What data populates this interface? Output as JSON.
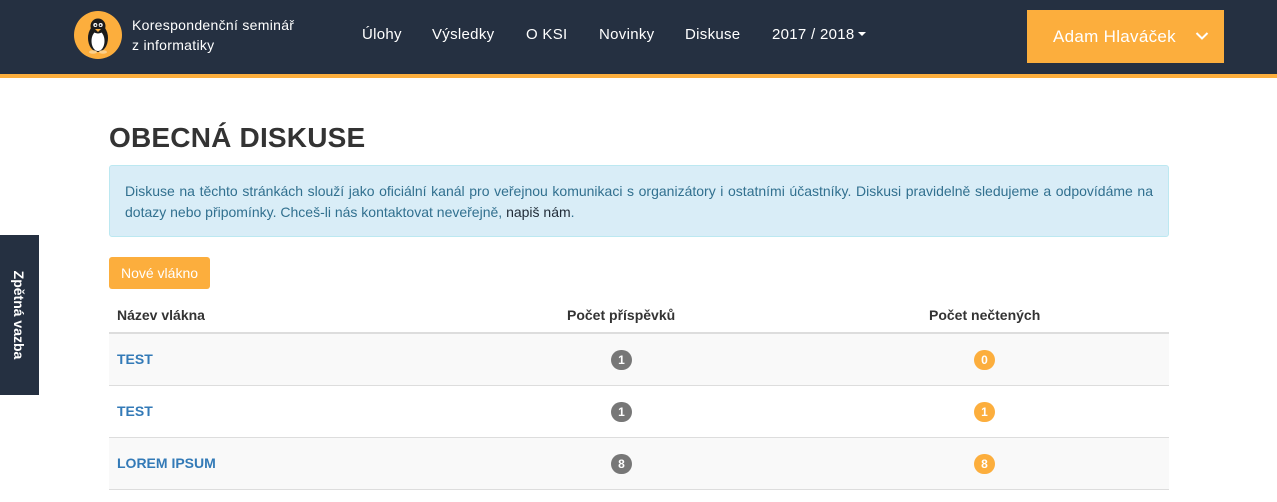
{
  "brand": {
    "line1": "Korespondenční seminář",
    "line2": "z informatiky"
  },
  "nav": {
    "items": [
      {
        "label": "Úlohy"
      },
      {
        "label": "Výsledky"
      },
      {
        "label": "O KSI"
      },
      {
        "label": "Novinky"
      },
      {
        "label": "Diskuse"
      }
    ],
    "year": "2017 / 2018",
    "user": "Adam Hlaváček"
  },
  "feedback": {
    "label": "Zpětná vazba"
  },
  "page": {
    "title": "OBECNÁ DISKUSE",
    "info_text": "Diskuse na těchto stránkách slouží jako oficiální kanál pro veřejnou komunikaci s organizátory i ostatními účastníky. Diskusi pravidelně sledujeme a odpovídáme na dotazy nebo připomínky. Chceš-li nás kontaktovat neveřejně, ",
    "info_link": "napiš nám",
    "info_end": ".",
    "new_thread": "Nové vlákno"
  },
  "table": {
    "headers": {
      "name": "Název vlákna",
      "posts": "Počet příspěvků",
      "unread": "Počet nečtených"
    },
    "rows": [
      {
        "name": "TEST",
        "posts": "1",
        "unread": "0"
      },
      {
        "name": "TEST",
        "posts": "1",
        "unread": "1"
      },
      {
        "name": "LOREM IPSUM",
        "posts": "8",
        "unread": "8"
      }
    ]
  },
  "colors": {
    "navbar": "#253041",
    "accent": "#fcae3d",
    "link": "#337ab7",
    "badge_grey": "#777777"
  }
}
